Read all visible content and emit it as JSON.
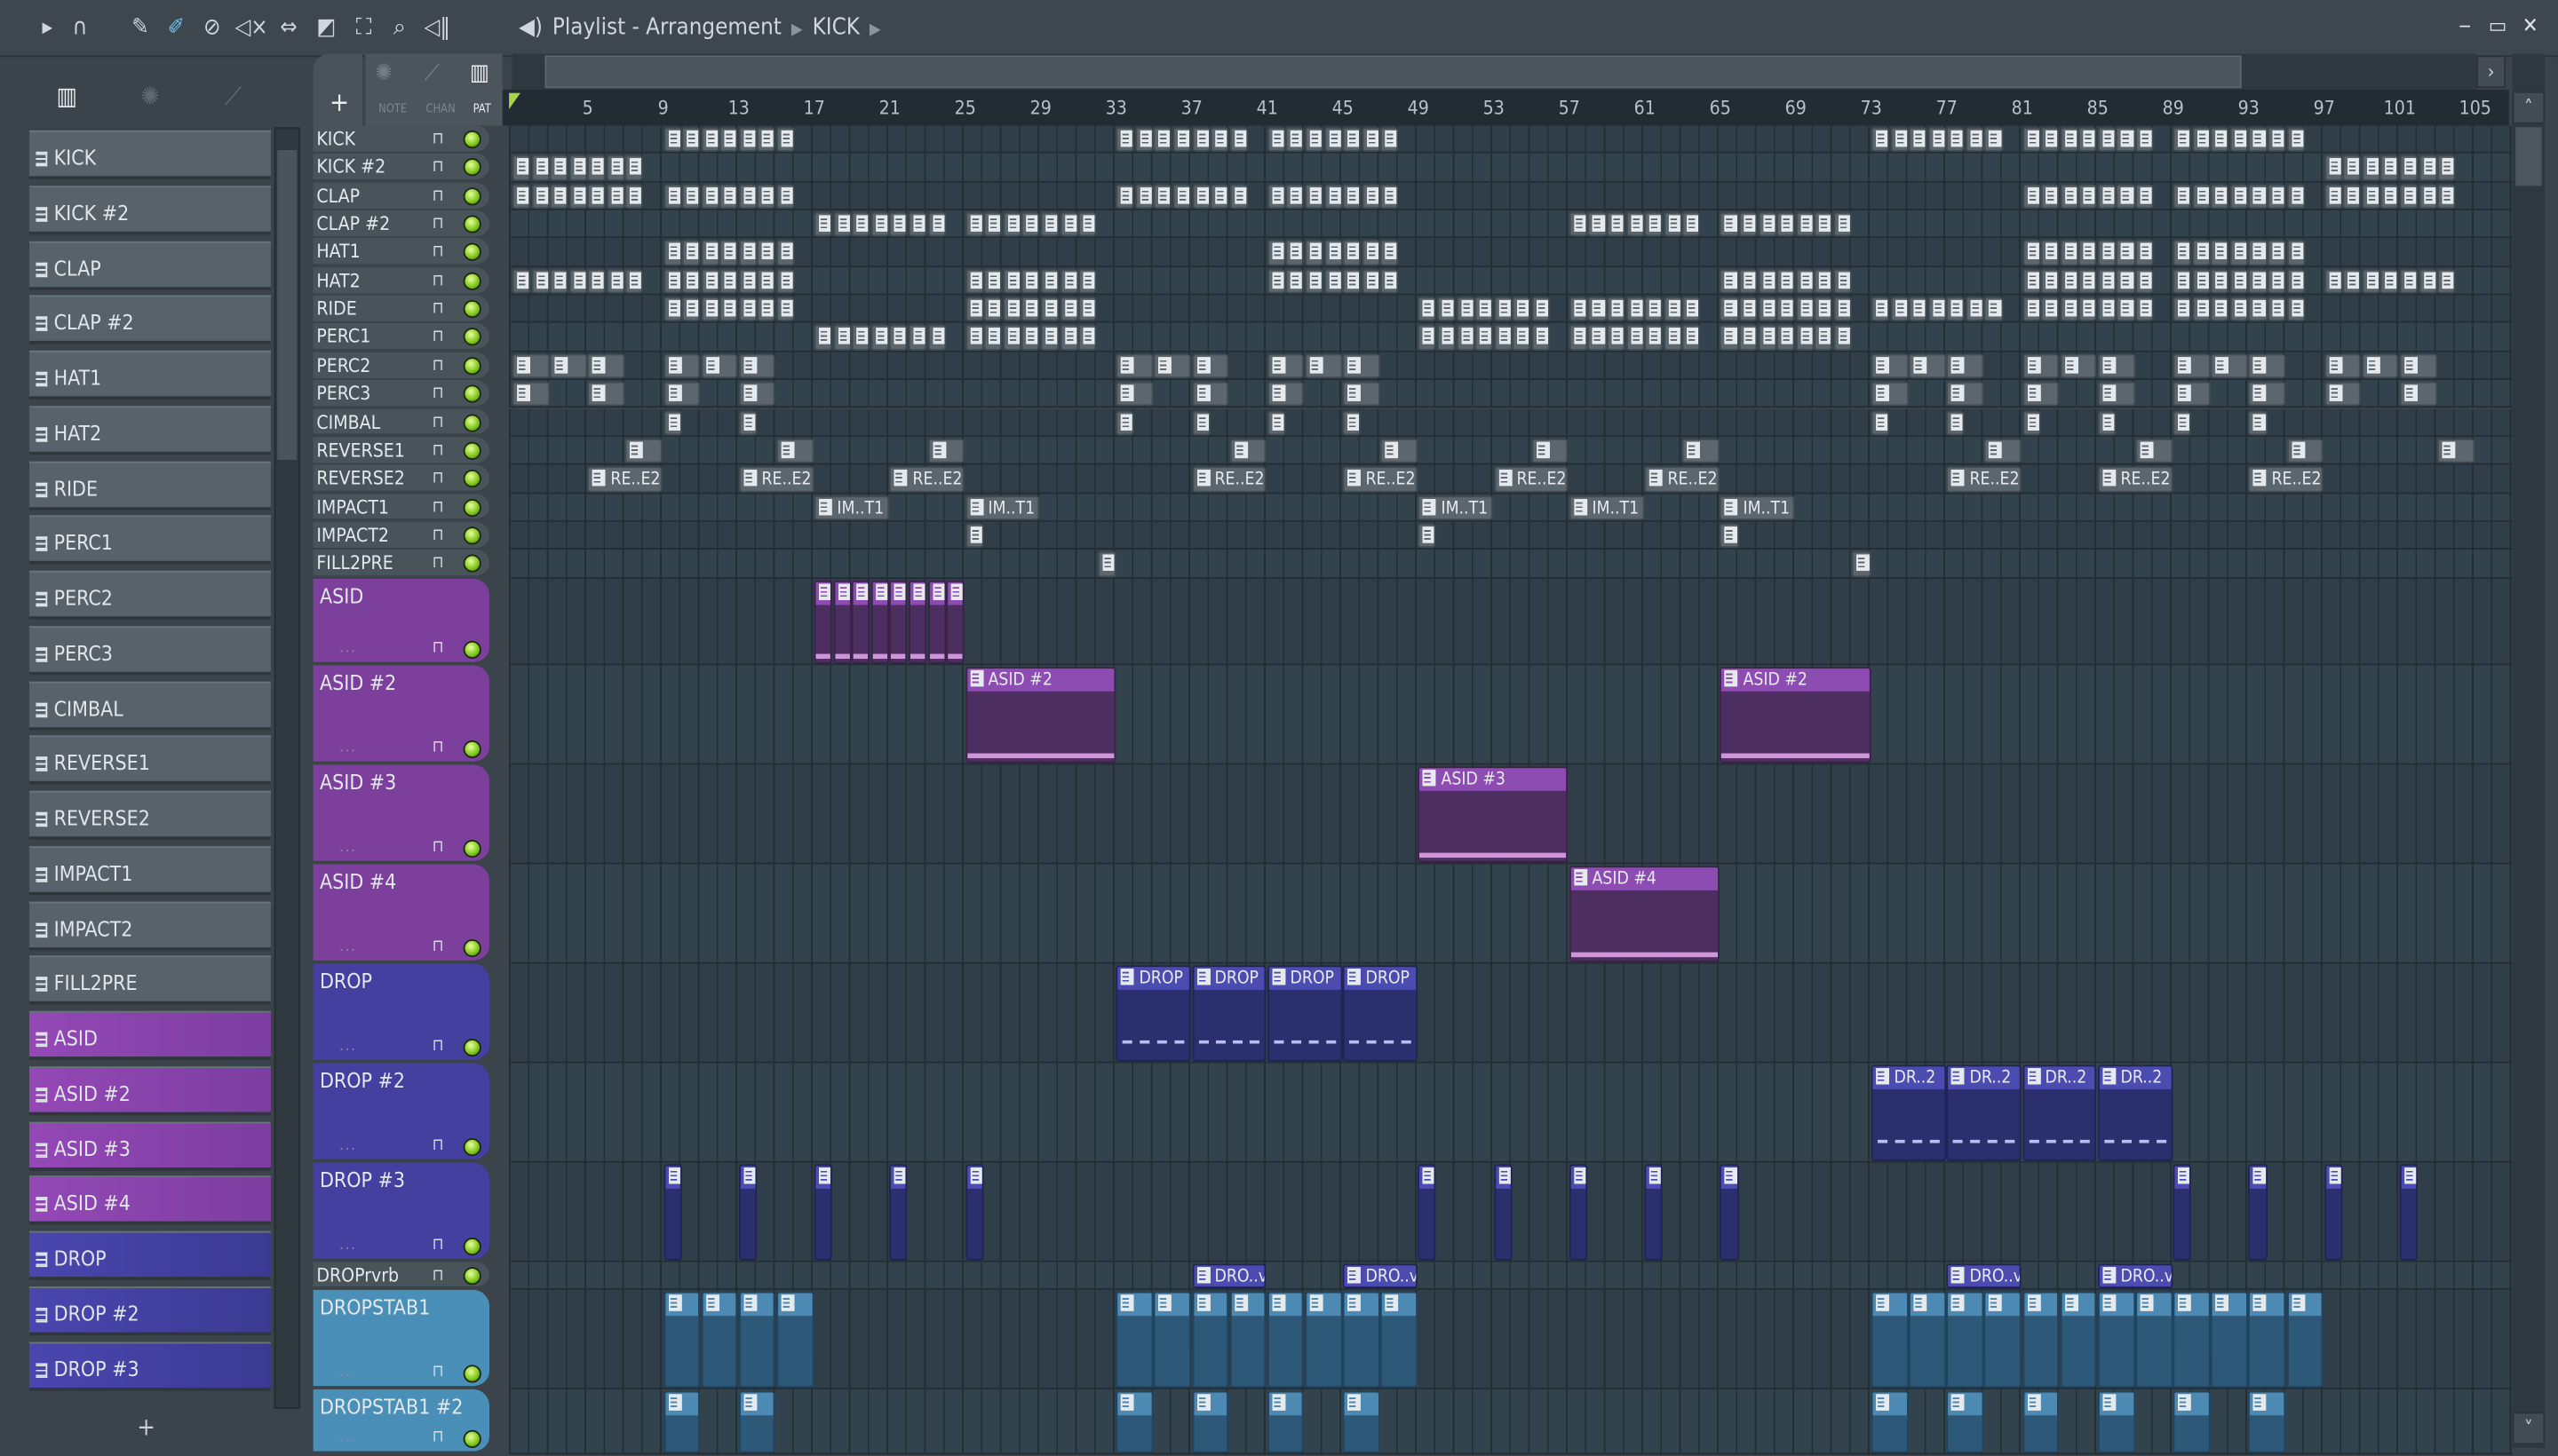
{
  "toolbar": {
    "icons": [
      "play-arrow-icon",
      "magnet-snap-icon",
      "pencil-icon",
      "paint-brush-icon",
      "delete-icon",
      "mute-icon",
      "slip-icon",
      "slice-icon",
      "select-icon",
      "zoom-icon",
      "playback-icon"
    ],
    "title": "Playlist - Arrangement",
    "breadcrumb": "KICK",
    "window_buttons": [
      "minimize",
      "maximize",
      "close"
    ]
  },
  "left_panel": {
    "tabs": [
      {
        "name": "piano-roll-tab-icon",
        "glyph": "▥",
        "active": true
      },
      {
        "name": "audio-tab-icon",
        "glyph": "✺",
        "active": false
      },
      {
        "name": "automation-tab-icon",
        "glyph": "⟋",
        "active": false
      }
    ],
    "channels": [
      {
        "label": "KICK",
        "color": "grey"
      },
      {
        "label": "KICK #2",
        "color": "grey"
      },
      {
        "label": "CLAP",
        "color": "grey"
      },
      {
        "label": "CLAP #2",
        "color": "grey"
      },
      {
        "label": "HAT1",
        "color": "grey"
      },
      {
        "label": "HAT2",
        "color": "grey"
      },
      {
        "label": "RIDE",
        "color": "grey"
      },
      {
        "label": "PERC1",
        "color": "grey"
      },
      {
        "label": "PERC2",
        "color": "grey"
      },
      {
        "label": "PERC3",
        "color": "grey"
      },
      {
        "label": "CIMBAL",
        "color": "grey"
      },
      {
        "label": "REVERSE1",
        "color": "grey"
      },
      {
        "label": "REVERSE2",
        "color": "grey"
      },
      {
        "label": "IMPACT1",
        "color": "grey"
      },
      {
        "label": "IMPACT2",
        "color": "grey"
      },
      {
        "label": "FILL2PRE",
        "color": "grey"
      },
      {
        "label": "ASID",
        "color": "purple"
      },
      {
        "label": "ASID #2",
        "color": "purple"
      },
      {
        "label": "ASID #3",
        "color": "purple"
      },
      {
        "label": "ASID #4",
        "color": "purple"
      },
      {
        "label": "DROP",
        "color": "blue"
      },
      {
        "label": "DROP #2",
        "color": "blue"
      },
      {
        "label": "DROP #3",
        "color": "blue"
      }
    ],
    "add_label": "+"
  },
  "mode": {
    "add_label": "+",
    "note": "NOTE",
    "chan": "CHAN",
    "pat": "PAT",
    "active": "PAT"
  },
  "ruler": {
    "labels": [
      5,
      9,
      13,
      17,
      21,
      25,
      29,
      33,
      37,
      41,
      45,
      49,
      53,
      57,
      61,
      65,
      69,
      73,
      77,
      81,
      85,
      89,
      93,
      97,
      101,
      105
    ]
  },
  "colors": {
    "grey": "#5c666e",
    "purple": "#8d4cb1",
    "blue": "#4b4bb0",
    "teal": "#4c8ab4",
    "grid": "#2f3e48",
    "led": "#7dc419"
  },
  "tracks": [
    {
      "name": "KICK",
      "color": "grey",
      "runs": [
        {
          "s": 9,
          "n": 7,
          "l": 1
        },
        {
          "s": 33,
          "n": 7,
          "l": 1
        },
        {
          "s": 41,
          "n": 7,
          "l": 1
        },
        {
          "s": 73,
          "n": 7,
          "l": 1
        },
        {
          "s": 81,
          "n": 7,
          "l": 1
        },
        {
          "s": 89,
          "n": 7,
          "l": 1
        }
      ]
    },
    {
      "name": "KICK #2",
      "color": "grey",
      "runs": [
        {
          "s": 1,
          "n": 7,
          "l": 1
        },
        {
          "s": 97,
          "n": 7,
          "l": 1
        }
      ]
    },
    {
      "name": "CLAP",
      "color": "grey",
      "runs": [
        {
          "s": 1,
          "n": 7,
          "l": 1
        },
        {
          "s": 9,
          "n": 7,
          "l": 1
        },
        {
          "s": 33,
          "n": 7,
          "l": 1
        },
        {
          "s": 41,
          "n": 7,
          "l": 1
        },
        {
          "s": 81,
          "n": 7,
          "l": 1
        },
        {
          "s": 89,
          "n": 7,
          "l": 1
        },
        {
          "s": 97,
          "n": 7,
          "l": 1
        }
      ]
    },
    {
      "name": "CLAP #2",
      "color": "grey",
      "runs": [
        {
          "s": 17,
          "n": 7,
          "l": 1
        },
        {
          "s": 25,
          "n": 7,
          "l": 1
        },
        {
          "s": 57,
          "n": 7,
          "l": 1
        },
        {
          "s": 65,
          "n": 7,
          "l": 1
        }
      ]
    },
    {
      "name": "HAT1",
      "color": "grey",
      "runs": [
        {
          "s": 9,
          "n": 7,
          "l": 1
        },
        {
          "s": 41,
          "n": 7,
          "l": 1
        },
        {
          "s": 81,
          "n": 7,
          "l": 1
        },
        {
          "s": 89,
          "n": 7,
          "l": 1
        }
      ]
    },
    {
      "name": "HAT2",
      "color": "grey",
      "runs": [
        {
          "s": 1,
          "n": 7,
          "l": 1
        },
        {
          "s": 9,
          "n": 7,
          "l": 1
        },
        {
          "s": 25,
          "n": 7,
          "l": 1
        },
        {
          "s": 41,
          "n": 7,
          "l": 1
        },
        {
          "s": 65,
          "n": 7,
          "l": 1
        },
        {
          "s": 81,
          "n": 7,
          "l": 1
        },
        {
          "s": 89,
          "n": 7,
          "l": 1
        },
        {
          "s": 97,
          "n": 7,
          "l": 1
        }
      ]
    },
    {
      "name": "RIDE",
      "color": "grey",
      "runs": [
        {
          "s": 9,
          "n": 7,
          "l": 1
        },
        {
          "s": 25,
          "n": 7,
          "l": 1
        },
        {
          "s": 49,
          "n": 7,
          "l": 1
        },
        {
          "s": 57,
          "n": 7,
          "l": 1
        },
        {
          "s": 65,
          "n": 7,
          "l": 1
        },
        {
          "s": 73,
          "n": 7,
          "l": 1
        },
        {
          "s": 81,
          "n": 7,
          "l": 1
        },
        {
          "s": 89,
          "n": 7,
          "l": 1
        }
      ]
    },
    {
      "name": "PERC1",
      "color": "grey",
      "runs": [
        {
          "s": 17,
          "n": 7,
          "l": 1
        },
        {
          "s": 25,
          "n": 7,
          "l": 1
        },
        {
          "s": 49,
          "n": 7,
          "l": 1
        },
        {
          "s": 57,
          "n": 7,
          "l": 1
        },
        {
          "s": 65,
          "n": 7,
          "l": 1
        }
      ]
    },
    {
      "name": "PERC2",
      "color": "grey",
      "runs": [
        {
          "s": 1,
          "n": 3,
          "l": 2
        },
        {
          "s": 9,
          "n": 3,
          "l": 2
        },
        {
          "s": 33,
          "n": 3,
          "l": 2
        },
        {
          "s": 41,
          "n": 3,
          "l": 2
        },
        {
          "s": 73,
          "n": 3,
          "l": 2
        },
        {
          "s": 81,
          "n": 3,
          "l": 2
        },
        {
          "s": 89,
          "n": 3,
          "l": 2
        },
        {
          "s": 97,
          "n": 3,
          "l": 2
        }
      ]
    },
    {
      "name": "PERC3",
      "color": "grey",
      "runs": [
        {
          "s": 1,
          "n": 1,
          "l": 2
        },
        {
          "s": 5,
          "n": 1,
          "l": 2
        },
        {
          "s": 9,
          "n": 1,
          "l": 2
        },
        {
          "s": 13,
          "n": 1,
          "l": 2
        },
        {
          "s": 33,
          "n": 1,
          "l": 2
        },
        {
          "s": 37,
          "n": 1,
          "l": 2
        },
        {
          "s": 41,
          "n": 1,
          "l": 2
        },
        {
          "s": 45,
          "n": 1,
          "l": 2
        },
        {
          "s": 73,
          "n": 1,
          "l": 2
        },
        {
          "s": 77,
          "n": 1,
          "l": 2
        },
        {
          "s": 81,
          "n": 1,
          "l": 2
        },
        {
          "s": 85,
          "n": 1,
          "l": 2
        },
        {
          "s": 89,
          "n": 1,
          "l": 2
        },
        {
          "s": 93,
          "n": 1,
          "l": 2
        },
        {
          "s": 97,
          "n": 1,
          "l": 2
        },
        {
          "s": 101,
          "n": 1,
          "l": 2
        }
      ]
    },
    {
      "name": "CIMBAL",
      "color": "grey",
      "runs": [
        {
          "s": 9,
          "n": 1,
          "l": 1
        },
        {
          "s": 13,
          "n": 1,
          "l": 1
        },
        {
          "s": 33,
          "n": 1,
          "l": 1
        },
        {
          "s": 37,
          "n": 1,
          "l": 1
        },
        {
          "s": 41,
          "n": 1,
          "l": 1
        },
        {
          "s": 45,
          "n": 1,
          "l": 1
        },
        {
          "s": 73,
          "n": 1,
          "l": 1
        },
        {
          "s": 77,
          "n": 1,
          "l": 1
        },
        {
          "s": 81,
          "n": 1,
          "l": 1
        },
        {
          "s": 85,
          "n": 1,
          "l": 1
        },
        {
          "s": 89,
          "n": 1,
          "l": 1
        },
        {
          "s": 93,
          "n": 1,
          "l": 1
        }
      ]
    },
    {
      "name": "REVERSE1",
      "color": "grey",
      "runs": [
        {
          "s": 7,
          "n": 1,
          "l": 2
        },
        {
          "s": 15,
          "n": 1,
          "l": 2
        },
        {
          "s": 23,
          "n": 1,
          "l": 2
        },
        {
          "s": 39,
          "n": 1,
          "l": 2
        },
        {
          "s": 47,
          "n": 1,
          "l": 2
        },
        {
          "s": 55,
          "n": 1,
          "l": 2
        },
        {
          "s": 63,
          "n": 1,
          "l": 2
        },
        {
          "s": 79,
          "n": 1,
          "l": 2
        },
        {
          "s": 87,
          "n": 1,
          "l": 2
        },
        {
          "s": 95,
          "n": 1,
          "l": 2
        },
        {
          "s": 103,
          "n": 1,
          "l": 2
        }
      ]
    },
    {
      "name": "REVERSE2",
      "color": "grey",
      "runs": [
        {
          "s": 5,
          "n": 1,
          "l": 4,
          "label": "RE..E2"
        },
        {
          "s": 13,
          "n": 1,
          "l": 4,
          "label": "RE..E2"
        },
        {
          "s": 21,
          "n": 1,
          "l": 4,
          "label": "RE..E2"
        },
        {
          "s": 37,
          "n": 1,
          "l": 4,
          "label": "RE..E2"
        },
        {
          "s": 45,
          "n": 1,
          "l": 4,
          "label": "RE..E2"
        },
        {
          "s": 53,
          "n": 1,
          "l": 4,
          "label": "RE..E2"
        },
        {
          "s": 61,
          "n": 1,
          "l": 4,
          "label": "RE..E2"
        },
        {
          "s": 77,
          "n": 1,
          "l": 4,
          "label": "RE..E2"
        },
        {
          "s": 85,
          "n": 1,
          "l": 4,
          "label": "RE..E2"
        },
        {
          "s": 93,
          "n": 1,
          "l": 4,
          "label": "RE..E2"
        }
      ]
    },
    {
      "name": "IMPACT1",
      "color": "grey",
      "runs": [
        {
          "s": 17,
          "n": 1,
          "l": 4,
          "label": "IM..T1"
        },
        {
          "s": 25,
          "n": 1,
          "l": 4,
          "label": "IM..T1"
        },
        {
          "s": 49,
          "n": 1,
          "l": 4,
          "label": "IM..T1"
        },
        {
          "s": 57,
          "n": 1,
          "l": 4,
          "label": "IM..T1"
        },
        {
          "s": 65,
          "n": 1,
          "l": 4,
          "label": "IM..T1"
        }
      ]
    },
    {
      "name": "IMPACT2",
      "color": "grey",
      "runs": [
        {
          "s": 25,
          "n": 1,
          "l": 1
        },
        {
          "s": 49,
          "n": 1,
          "l": 1
        },
        {
          "s": 65,
          "n": 1,
          "l": 1
        }
      ]
    },
    {
      "name": "FILL2PRE",
      "color": "grey",
      "runs": [
        {
          "s": 32,
          "n": 1,
          "l": 1
        },
        {
          "s": 72,
          "n": 1,
          "l": 1
        }
      ]
    },
    {
      "name": "ASID",
      "color": "purple",
      "runs": [
        {
          "s": 17,
          "n": 8,
          "l": 1,
          "notes": true
        }
      ]
    },
    {
      "name": "ASID #2",
      "color": "purple",
      "runs": [
        {
          "s": 25,
          "n": 1,
          "l": 8,
          "label": "ASID #2",
          "notes": true
        },
        {
          "s": 65,
          "n": 1,
          "l": 8,
          "label": "ASID #2",
          "notes": true
        }
      ]
    },
    {
      "name": "ASID #3",
      "color": "purple",
      "runs": [
        {
          "s": 49,
          "n": 1,
          "l": 8,
          "label": "ASID #3",
          "notes": true
        }
      ]
    },
    {
      "name": "ASID #4",
      "color": "purple",
      "runs": [
        {
          "s": 57,
          "n": 1,
          "l": 8,
          "label": "ASID #4",
          "notes": true
        }
      ]
    },
    {
      "name": "DROP",
      "color": "blue",
      "runs": [
        {
          "s": 33,
          "n": 4,
          "l": 4,
          "label": "DROP",
          "wave": true
        }
      ]
    },
    {
      "name": "DROP #2",
      "color": "blue",
      "runs": [
        {
          "s": 73,
          "n": 4,
          "l": 4,
          "label": "DR..2",
          "wave": true
        }
      ]
    },
    {
      "name": "DROP #3",
      "color": "blue",
      "runs": [
        {
          "s": 9,
          "n": 1,
          "l": 1
        },
        {
          "s": 13,
          "n": 1,
          "l": 1
        },
        {
          "s": 17,
          "n": 1,
          "l": 1
        },
        {
          "s": 21,
          "n": 1,
          "l": 1
        },
        {
          "s": 25,
          "n": 1,
          "l": 1
        },
        {
          "s": 49,
          "n": 1,
          "l": 1
        },
        {
          "s": 53,
          "n": 1,
          "l": 1
        },
        {
          "s": 57,
          "n": 1,
          "l": 1
        },
        {
          "s": 61,
          "n": 1,
          "l": 1
        },
        {
          "s": 65,
          "n": 1,
          "l": 1
        },
        {
          "s": 89,
          "n": 1,
          "l": 1
        },
        {
          "s": 93,
          "n": 1,
          "l": 1
        },
        {
          "s": 97,
          "n": 1,
          "l": 1
        },
        {
          "s": 101,
          "n": 1,
          "l": 1
        }
      ]
    },
    {
      "name": "DROPrvrb",
      "color": "grey",
      "runs": [
        {
          "s": 37,
          "n": 1,
          "l": 4,
          "label": "DRO..vrb",
          "c": "blue"
        },
        {
          "s": 45,
          "n": 1,
          "l": 4,
          "label": "DRO..vrb",
          "c": "blue"
        },
        {
          "s": 77,
          "n": 1,
          "l": 4,
          "label": "DRO..vrb",
          "c": "blue"
        },
        {
          "s": 85,
          "n": 1,
          "l": 4,
          "label": "DRO..vrb",
          "c": "blue"
        }
      ]
    },
    {
      "name": "DROPSTAB1",
      "color": "teal",
      "runs": [
        {
          "s": 9,
          "n": 4,
          "l": 2
        },
        {
          "s": 33,
          "n": 8,
          "l": 2
        },
        {
          "s": 73,
          "n": 12,
          "l": 2
        }
      ]
    },
    {
      "name": "DROPSTAB1 #2",
      "color": "teal",
      "runs": [
        {
          "s": 9,
          "n": 1,
          "l": 2
        },
        {
          "s": 13,
          "n": 1,
          "l": 2
        },
        {
          "s": 33,
          "n": 1,
          "l": 2
        },
        {
          "s": 37,
          "n": 1,
          "l": 2
        },
        {
          "s": 41,
          "n": 1,
          "l": 2
        },
        {
          "s": 45,
          "n": 1,
          "l": 2
        },
        {
          "s": 73,
          "n": 1,
          "l": 2
        },
        {
          "s": 77,
          "n": 1,
          "l": 2
        },
        {
          "s": 81,
          "n": 1,
          "l": 2
        },
        {
          "s": 85,
          "n": 1,
          "l": 2
        },
        {
          "s": 89,
          "n": 1,
          "l": 2
        },
        {
          "s": 93,
          "n": 1,
          "l": 2
        }
      ]
    }
  ]
}
